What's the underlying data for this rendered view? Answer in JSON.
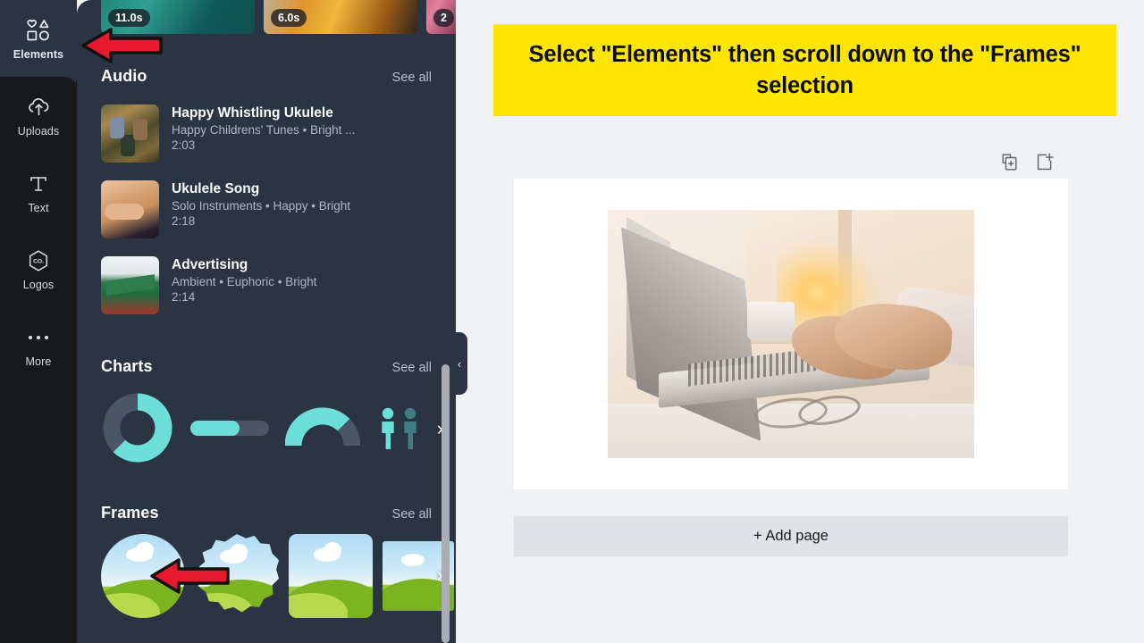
{
  "rail": {
    "items": [
      {
        "label": "Elements",
        "icon": "shapes-icon",
        "active": true
      },
      {
        "label": "Uploads",
        "icon": "cloud-upload-icon",
        "active": false
      },
      {
        "label": "Text",
        "icon": "text-t-icon",
        "active": false
      },
      {
        "label": "Logos",
        "icon": "logo-hexagon-icon",
        "active": false
      },
      {
        "label": "More",
        "icon": "ellipsis-icon",
        "active": false
      }
    ]
  },
  "panel": {
    "video_strip": [
      {
        "duration": "11.0s"
      },
      {
        "duration": "6.0s"
      },
      {
        "duration": "2"
      }
    ],
    "sections": {
      "audio": {
        "title": "Audio",
        "see_all": "See all",
        "tracks": [
          {
            "name": "Happy Whistling Ukulele",
            "tags": "Happy Childrens' Tunes • Bright ...",
            "duration": "2:03"
          },
          {
            "name": "Ukulele Song",
            "tags": "Solo Instruments • Happy • Bright",
            "duration": "2:18"
          },
          {
            "name": "Advertising",
            "tags": "Ambient • Euphoric • Bright",
            "duration": "2:14"
          }
        ]
      },
      "charts": {
        "title": "Charts",
        "see_all": "See all",
        "next_arrow": "›",
        "items": [
          "donut-chart",
          "progress-bar-chart",
          "gauge-chart",
          "pictogram-chart"
        ]
      },
      "frames": {
        "title": "Frames",
        "see_all": "See all",
        "next_arrow": "›",
        "items": [
          "circle-frame",
          "scalloped-frame",
          "rounded-square-frame",
          "square-frame"
        ]
      }
    },
    "collapse_chevron": "‹"
  },
  "canvas": {
    "banner_text": "Select \"Elements\" then scroll down to the \"Frames\" selection",
    "banner_color": "#ffe600",
    "tools": [
      {
        "name": "duplicate-page-icon"
      },
      {
        "name": "add-page-icon"
      }
    ],
    "add_page_label": "+ Add page"
  },
  "annotations": {
    "arrow_color": "#e8192c",
    "arrows": [
      {
        "target": "elements-rail-item",
        "direction": "left"
      },
      {
        "target": "frames-first-item",
        "direction": "left"
      }
    ]
  }
}
